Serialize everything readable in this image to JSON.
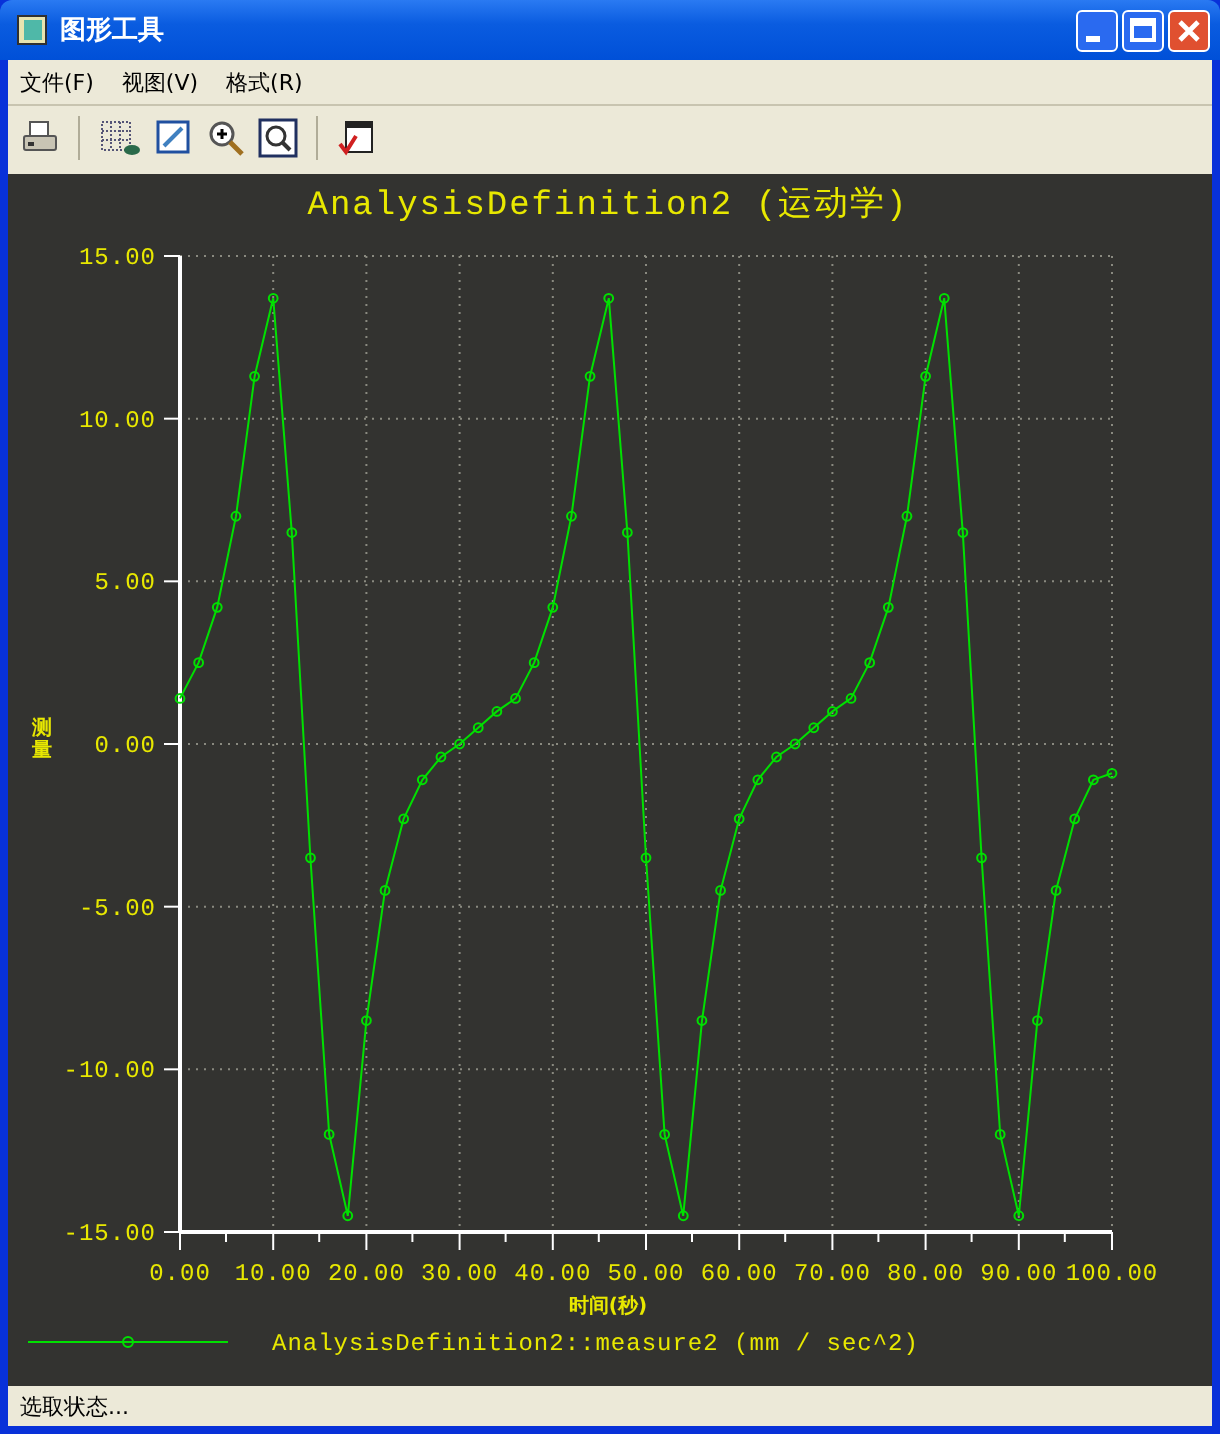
{
  "window": {
    "title": "图形工具"
  },
  "menu": [
    "文件(F)",
    "视图(V)",
    "格式(R)"
  ],
  "chart": {
    "chart_data": {
      "type": "line",
      "title": "AnalysisDefinition2 (运动学)",
      "xlabel": "时间(秒)",
      "ylabel": "测量",
      "x": [
        0,
        2,
        4,
        6,
        8,
        10,
        12,
        14,
        16,
        18,
        20,
        22,
        24,
        26,
        28,
        30,
        32,
        34,
        36,
        38,
        40,
        42,
        44,
        46,
        48,
        50,
        52,
        54,
        56,
        58,
        60,
        62,
        64,
        66,
        68,
        70,
        72,
        74,
        76,
        78,
        80,
        82,
        84,
        86,
        88,
        90,
        92,
        94,
        96,
        98,
        100
      ],
      "series": [
        {
          "name": "AnalysisDefinition2::measure2 (mm / sec^2)",
          "color": "#00e000",
          "marker": "circle",
          "values": [
            1.4,
            2.5,
            4.2,
            7.0,
            11.3,
            13.7,
            6.5,
            -3.5,
            -12,
            -14.5,
            -8.5,
            -4.5,
            -2.3,
            -1.1,
            -0.4,
            0,
            0.5,
            1.0,
            1.4,
            2.5,
            4.2,
            7.0,
            11.3,
            13.7,
            6.5,
            -3.5,
            -12,
            -14.5,
            -8.5,
            -4.5,
            -2.3,
            -1.1,
            -0.4,
            0,
            0.5,
            1.0,
            1.4,
            2.5,
            4.2,
            7.0,
            11.3,
            13.7,
            6.5,
            -3.5,
            -12,
            -14.5,
            -8.5,
            -4.5,
            -2.3,
            -1.1,
            -0.9
          ]
        }
      ],
      "xlim": [
        0,
        100
      ],
      "ylim": [
        -15,
        15
      ],
      "grid": true,
      "xticks": [
        {
          "value": 0,
          "label": "0.00"
        },
        {
          "value": 10,
          "label": "10.00"
        },
        {
          "value": 20,
          "label": "20.00"
        },
        {
          "value": 30,
          "label": "30.00"
        },
        {
          "value": 40,
          "label": "40.00"
        },
        {
          "value": 50,
          "label": "50.00"
        },
        {
          "value": 60,
          "label": "60.00"
        },
        {
          "value": 70,
          "label": "70.00"
        },
        {
          "value": 80,
          "label": "80.00"
        },
        {
          "value": 90,
          "label": "90.00"
        },
        {
          "value": 100,
          "label": "100.00"
        }
      ],
      "yticks": [
        {
          "value": 15,
          "label": "15.00"
        },
        {
          "value": 10,
          "label": "10.00"
        },
        {
          "value": 5,
          "label": "5.00"
        },
        {
          "value": 0,
          "label": "0.00"
        },
        {
          "value": -5,
          "label": "-5.00"
        },
        {
          "value": -10,
          "label": "-10.00"
        },
        {
          "value": -15,
          "label": "-15.00"
        }
      ]
    }
  },
  "status_bar": "选取状态..."
}
